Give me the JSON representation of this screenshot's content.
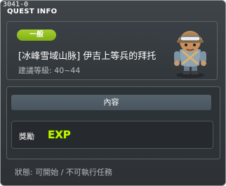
{
  "window": {
    "id_label": "3041-0",
    "title": "QUEST INFO"
  },
  "quest": {
    "category": "一般",
    "name": "[冰峰雪域山脉] 伊吉上等兵的拜托",
    "level_requirement": "建議等級: 40~44",
    "npc_icon": "soldier-npc-portrait-icon"
  },
  "content": {
    "header": "內容",
    "reward_label": "獎勵",
    "reward_item": "EXP",
    "reward_icon": "exp-icon"
  },
  "status": "狀態: 可開始 / 不可執行任務",
  "colors": {
    "badge_green": "#8fc21f",
    "exp_text": "#c8f400",
    "background": "#33383c"
  }
}
